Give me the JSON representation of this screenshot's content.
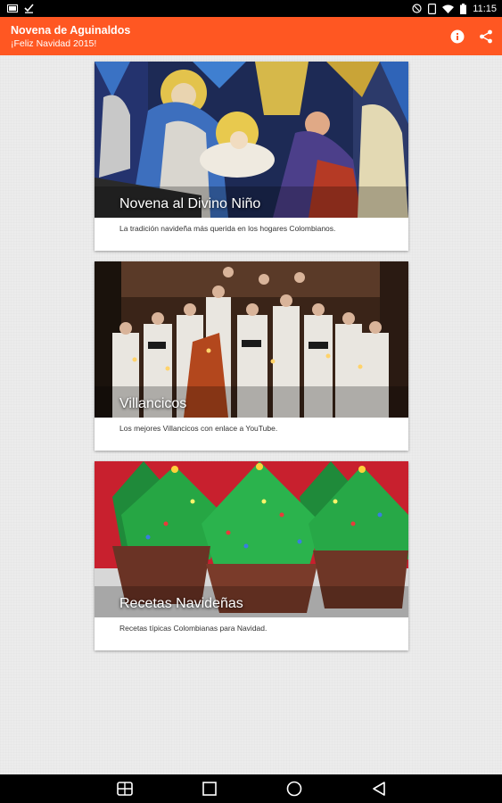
{
  "status_bar": {
    "time": "11:15",
    "icons": [
      "screenshot-icon",
      "download-done-icon",
      "alarm-icon",
      "vibrate-icon",
      "wifi-icon",
      "battery-icon"
    ]
  },
  "app_bar": {
    "title": "Novena de Aguinaldos",
    "subtitle": "¡Feliz Navidad 2015!",
    "background": "#ff5722",
    "actions": [
      "info-icon",
      "share-icon"
    ]
  },
  "cards": [
    {
      "title": "Novena al Divino Niño",
      "description": "La tradición navideña más querida en los hogares Colombianos.",
      "image": "stained-glass-nativity"
    },
    {
      "title": "Villancicos",
      "description": "Los mejores Villancicos con enlace a YouTube.",
      "image": "choir-candles"
    },
    {
      "title": "Recetas Navideñas",
      "description": "Recetas típicas Colombianas para Navidad.",
      "image": "christmas-tree-cupcakes"
    }
  ],
  "nav_bar": {
    "icons": [
      "screenshot-nav-icon",
      "recents-icon",
      "home-icon",
      "back-icon"
    ]
  }
}
